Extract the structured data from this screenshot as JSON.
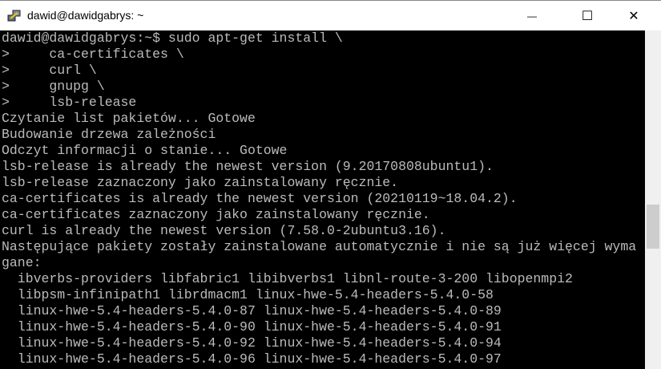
{
  "window": {
    "title": "dawid@dawidgabrys: ~",
    "icon": "putty-icon",
    "minimize_label": "—",
    "maximize_label": "☐",
    "close_label": "✕"
  },
  "terminal": {
    "fg_color": "#bbbbbb",
    "bg_color": "#000000",
    "lines": [
      "dawid@dawidgabrys:~$ sudo apt-get install \\",
      ">     ca-certificates \\",
      ">     curl \\",
      ">     gnupg \\",
      ">     lsb-release",
      "Czytanie list pakietów... Gotowe",
      "Budowanie drzewa zależności",
      "Odczyt informacji o stanie... Gotowe",
      "lsb-release is already the newest version (9.20170808ubuntu1).",
      "lsb-release zaznaczony jako zainstalowany ręcznie.",
      "ca-certificates is already the newest version (20210119~18.04.2).",
      "ca-certificates zaznaczony jako zainstalowany ręcznie.",
      "curl is already the newest version (7.58.0-2ubuntu3.16).",
      "Następujące pakiety zostały zainstalowane automatycznie i nie są już więcej wyma",
      "gane:",
      "  ibverbs-providers libfabric1 libibverbs1 libnl-route-3-200 libopenmpi2",
      "  libpsm-infinipath1 librdmacm1 linux-hwe-5.4-headers-5.4.0-58",
      "  linux-hwe-5.4-headers-5.4.0-87 linux-hwe-5.4-headers-5.4.0-89",
      "  linux-hwe-5.4-headers-5.4.0-90 linux-hwe-5.4-headers-5.4.0-91",
      "  linux-hwe-5.4-headers-5.4.0-92 linux-hwe-5.4-headers-5.4.0-94",
      "  linux-hwe-5.4-headers-5.4.0-96 linux-hwe-5.4-headers-5.4.0-97"
    ]
  },
  "scrollbar": {
    "position_fraction": 0.55
  }
}
